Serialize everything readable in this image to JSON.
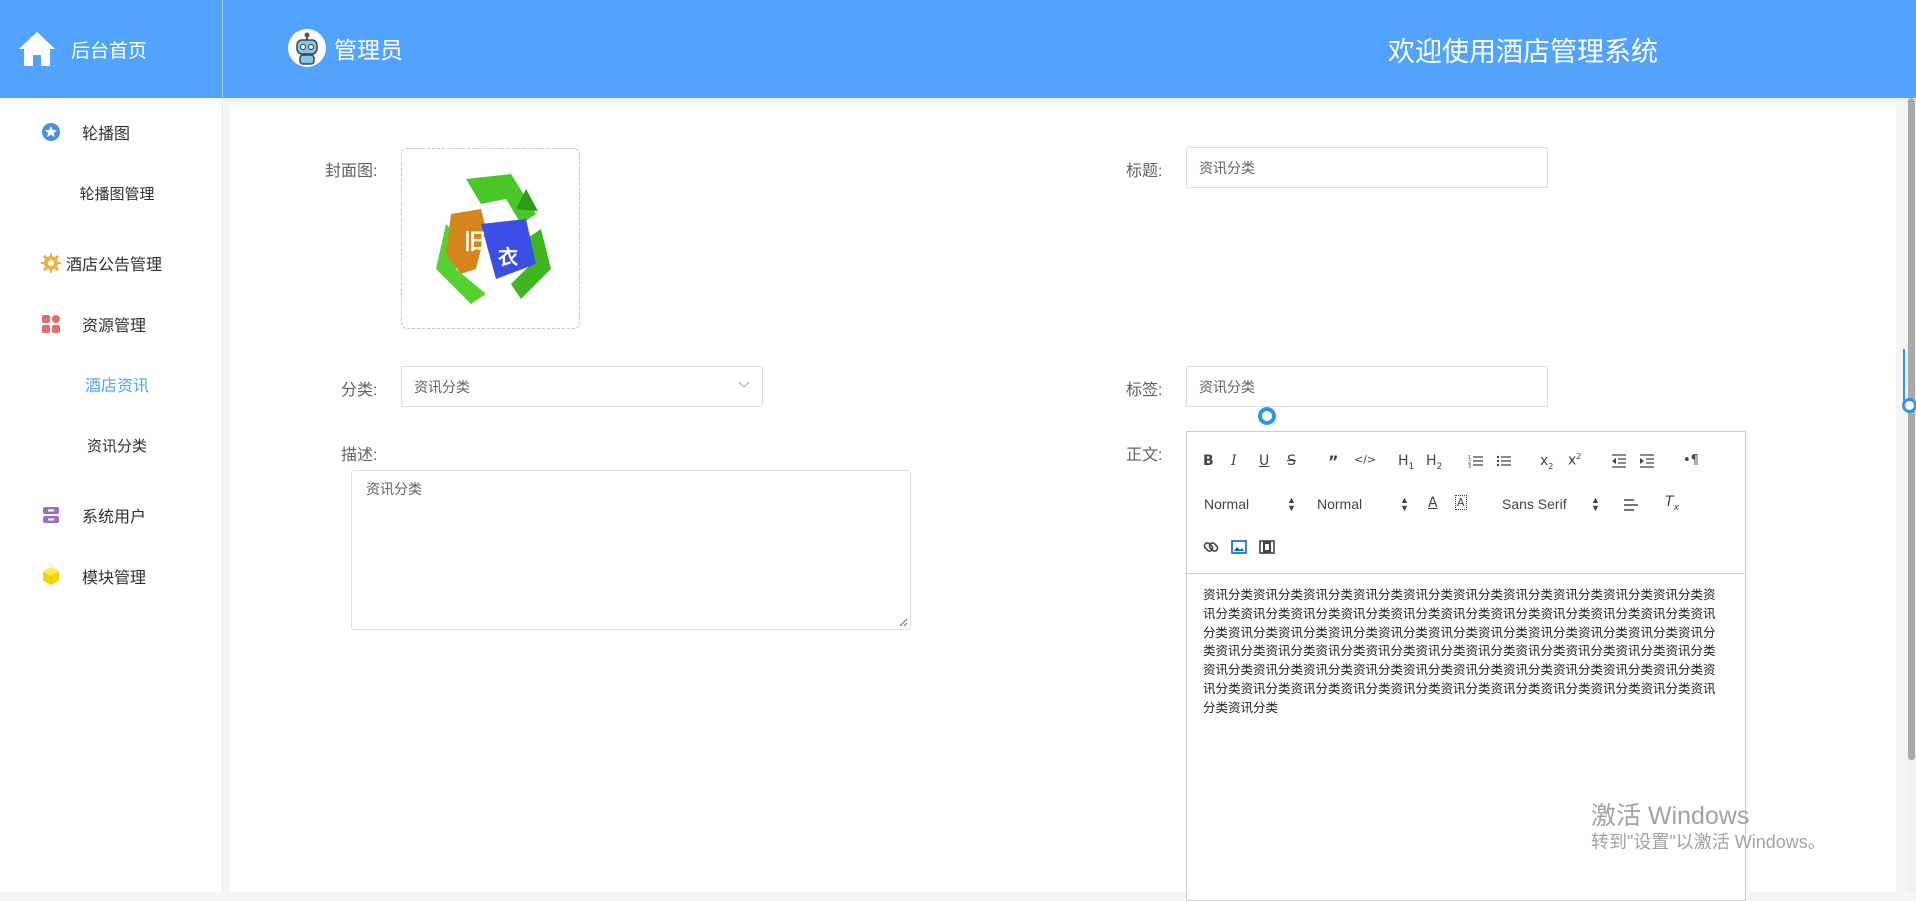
{
  "header": {
    "home_label": "后台首页",
    "admin_name": "管理员",
    "welcome": "欢迎使用酒店管理系统",
    "colors": {
      "bar": "#51a3fb",
      "text": "#ffffff"
    }
  },
  "sidebar": {
    "items": [
      {
        "label": "轮播图",
        "icon": "star-icon",
        "color": "#4a90e2"
      },
      {
        "label": "轮播图管理",
        "sub": true
      },
      {
        "label": "酒店公告管理",
        "icon": "gear-icon",
        "color": "#f0ad4e"
      },
      {
        "label": "资源管理",
        "icon": "grid-icon",
        "color": "#e86b6b"
      },
      {
        "label": "酒店资讯",
        "sub": true,
        "active": true
      },
      {
        "label": "资讯分类",
        "sub": true
      },
      {
        "label": "系统用户",
        "icon": "archive-icon",
        "color": "#9b6fc3"
      },
      {
        "label": "模块管理",
        "icon": "cube-icon",
        "color": "#f5d400"
      }
    ],
    "active_color": "#51a3fb"
  },
  "form": {
    "cover_label": "封面图:",
    "title_label": "标题:",
    "title_value": "资讯分类",
    "category_label": "分类:",
    "category_value": "资讯分类",
    "tag_label": "标签:",
    "tag_value": "资讯分类",
    "desc_label": "描述:",
    "desc_value": "资讯分类",
    "body_label": "正文:"
  },
  "cover_image": {
    "text_1": "旧",
    "text_2": "衣"
  },
  "editor": {
    "header_select": "Normal",
    "size_select": "Normal",
    "font_select": "Sans Serif",
    "content": "资讯分类资讯分类资讯分类资讯分类资讯分类资讯分类资讯分类资讯分类资讯分类资讯分类资讯分类资讯分类资讯分类资讯分类资讯分类资讯分类资讯分类资讯分类资讯分类资讯分类资讯分类资讯分类资讯分类资讯分类资讯分类资讯分类资讯分类资讯分类资讯分类资讯分类资讯分类资讯分类资讯分类资讯分类资讯分类资讯分类资讯分类资讯分类资讯分类资讯分类资讯分类资讯分类资讯分类资讯分类资讯分类资讯分类资讯分类资讯分类资讯分类资讯分类资讯分类资讯分类资讯分类资讯分类资讯分类资讯分类资讯分类资讯分类资讯分类资讯分类资讯分类资讯分类资讯分类",
    "toolbar_icons": [
      "bold-icon",
      "italic-icon",
      "underline-icon",
      "strike-icon",
      "blockquote-icon",
      "code-block-icon",
      "h1-icon",
      "h2-icon",
      "ordered-list-icon",
      "bullet-list-icon",
      "subscript-icon",
      "superscript-icon",
      "outdent-icon",
      "indent-icon",
      "rtl-icon",
      "color-icon",
      "background-icon",
      "align-icon",
      "clean-icon",
      "link-icon",
      "image-icon",
      "video-icon"
    ]
  },
  "watermark": {
    "line1": "激活 Windows",
    "line2": "转到\"设置\"以激活 Windows。"
  }
}
